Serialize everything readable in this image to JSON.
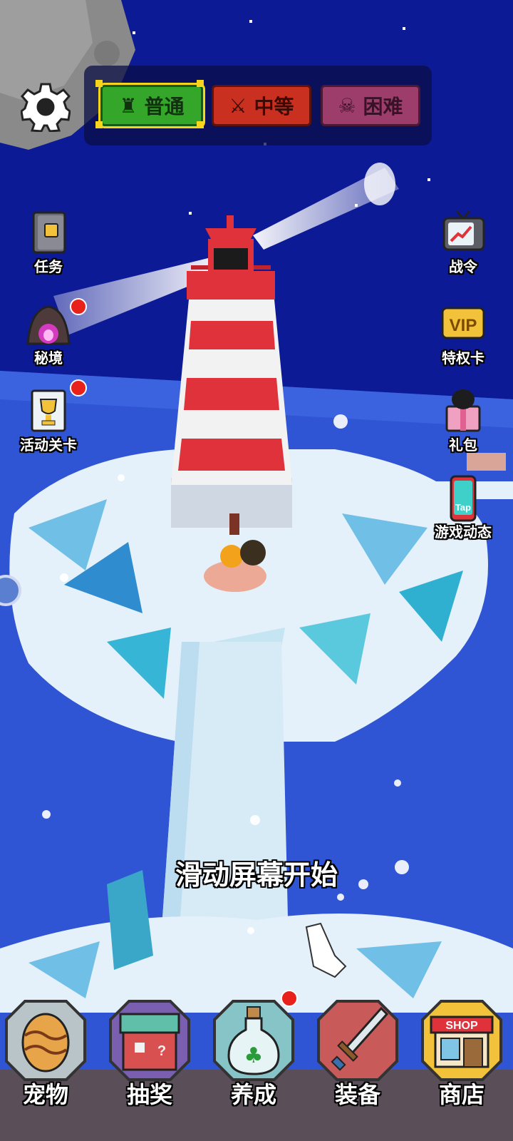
{
  "difficulty": {
    "normal": "普通",
    "medium": "中等",
    "hard": "困难",
    "selected": "普通"
  },
  "left_menu": {
    "tasks": "任务",
    "secret_realm": "秘境",
    "event_levels": "活动关卡"
  },
  "right_menu": {
    "battle_pass": "战令",
    "vip_card": "特权卡",
    "vip_badge": "VIP",
    "gift_pack": "礼包",
    "game_news": "游戏动态",
    "tap_badge": "Tap"
  },
  "hint": "滑动屏幕开始",
  "bottom_nav": {
    "pets": "宠物",
    "lottery": "抽奖",
    "nurture": "养成",
    "equipment": "装备",
    "shop": "商店",
    "shop_sign": "SHOP"
  },
  "colors": {
    "sky": "#0d1a96",
    "ocean": "#2f55d4",
    "ice": "#e4f1fa",
    "lighthouse_red": "#e0323a",
    "normal_green": "#34a62a",
    "medium_red": "#c9301f",
    "hard_purple": "#9d3d6c",
    "notification_red": "#e8211b"
  },
  "icons": [
    "settings-gear-icon",
    "book-icon",
    "cave-icon",
    "trophy-icon",
    "tv-chart-icon",
    "vip-icon",
    "gift-box-icon",
    "phone-tap-icon",
    "egg-icon",
    "mystery-box-icon",
    "clover-bottle-icon",
    "sword-icon",
    "shop-icon"
  ]
}
